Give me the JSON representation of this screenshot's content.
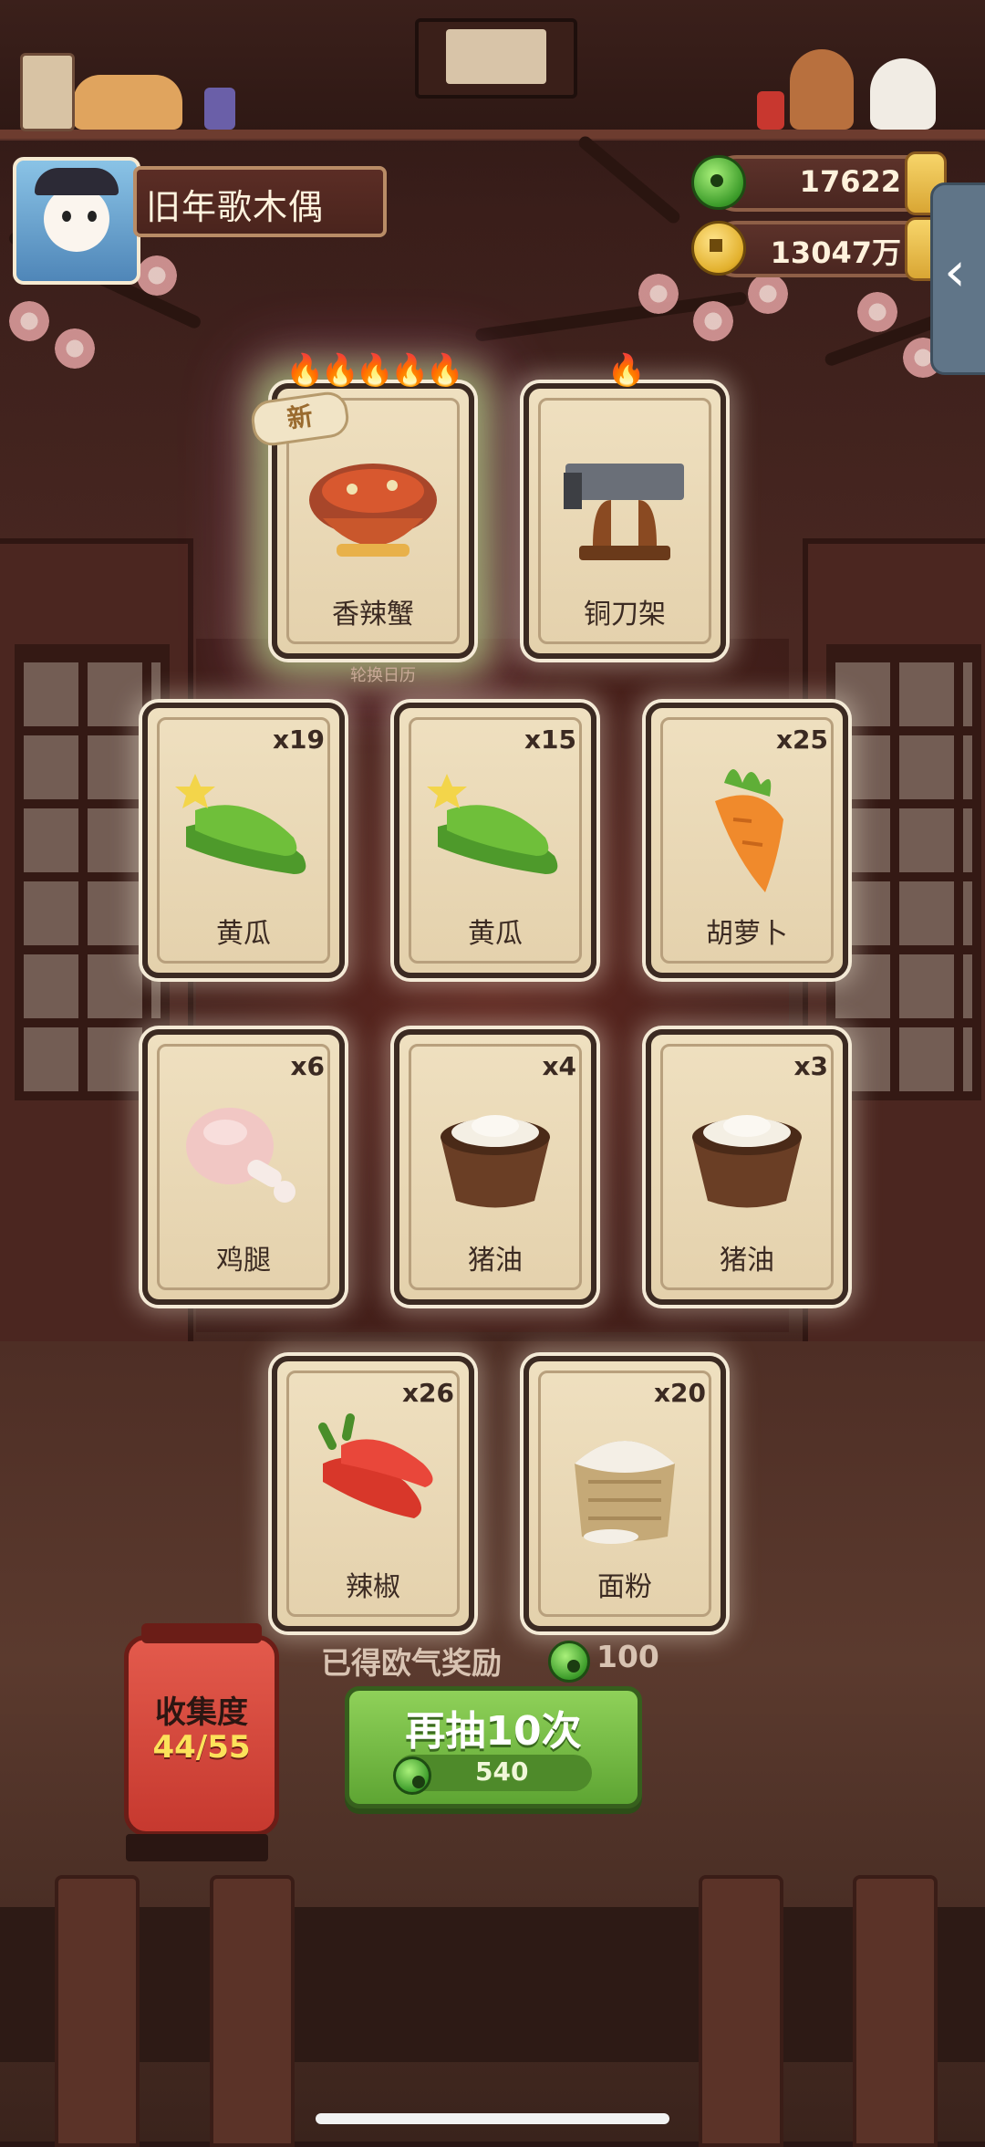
{
  "player": {
    "name": "旧年歌木偶"
  },
  "currencies": [
    {
      "id": "jade",
      "value": "17622",
      "icon": "jade-coin-icon"
    },
    {
      "id": "gold",
      "value": "13047万",
      "icon": "gold-coin-icon"
    }
  ],
  "side_tab": {
    "glyph": "‹"
  },
  "featured": {
    "caption": "轮换日历",
    "cards": [
      {
        "label": "香辣蟹",
        "flames": 5,
        "is_new": true,
        "badge": "新",
        "art": "spicy-crab-icon"
      },
      {
        "label": "铜刀架",
        "flames": 1,
        "is_new": false,
        "art": "copper-knife-rack-icon"
      }
    ]
  },
  "cards": [
    {
      "label": "黄瓜",
      "count": "x19",
      "art": "cucumber-icon"
    },
    {
      "label": "黄瓜",
      "count": "x15",
      "art": "cucumber-icon"
    },
    {
      "label": "胡萝卜",
      "count": "x25",
      "art": "carrot-icon"
    },
    {
      "label": "鸡腿",
      "count": "x6",
      "art": "chicken-leg-icon"
    },
    {
      "label": "猪油",
      "count": "x4",
      "art": "lard-icon"
    },
    {
      "label": "猪油",
      "count": "x3",
      "art": "lard-icon"
    },
    {
      "label": "辣椒",
      "count": "x26",
      "art": "chili-pepper-icon"
    },
    {
      "label": "面粉",
      "count": "x20",
      "art": "flour-sack-icon"
    }
  ],
  "reward": {
    "label": "已得欧气奖励",
    "value": "100"
  },
  "draw_button": {
    "label": "再抽10次",
    "cost": "540"
  },
  "collection": {
    "label": "收集度",
    "progress": "44/55"
  },
  "colors": {
    "card_bg": "#efe0c0",
    "button_green": "#8fd159",
    "lantern_red": "#e35a4c",
    "progress_yellow": "#fce25a"
  }
}
